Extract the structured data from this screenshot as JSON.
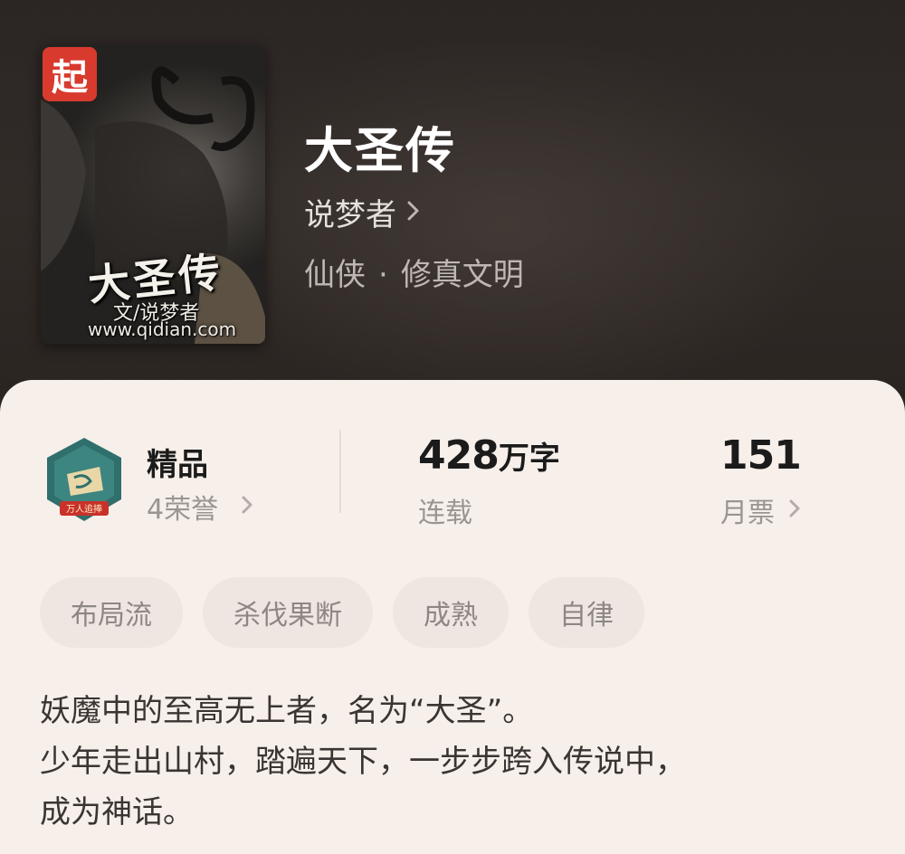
{
  "book": {
    "title": "大圣传",
    "author": "说梦者",
    "genre": "仙侠",
    "genre_separator": "·",
    "subgenre": "修真文明"
  },
  "cover": {
    "badge_text": "起",
    "title_text": "大圣传",
    "author_text": "文/说梦者",
    "url_text": "www.qidian.com"
  },
  "stats": {
    "honor": {
      "label": "精品",
      "sub": "4荣誉",
      "medal_text": "万人追捧"
    },
    "words": {
      "number": "428",
      "unit": "万字",
      "sub": "连载"
    },
    "votes": {
      "number": "151",
      "sub": "月票"
    }
  },
  "tags": [
    "布局流",
    "杀伐果断",
    "成熟",
    "自律"
  ],
  "description": [
    "妖魔中的至高无上者，名为“大圣”。",
    "少年走出山村，踏遍天下，一步步跨入传说中，",
    "成为神话。"
  ],
  "colors": {
    "hero_bg": "#2b2624",
    "panel_bg": "#f7efea",
    "tag_bg": "#efe6e1",
    "badge_red": "#d83a2e",
    "medal_teal": "#2f6f6c"
  },
  "icons": {
    "chevron": "chevron-right-icon",
    "medal": "medal-icon"
  }
}
